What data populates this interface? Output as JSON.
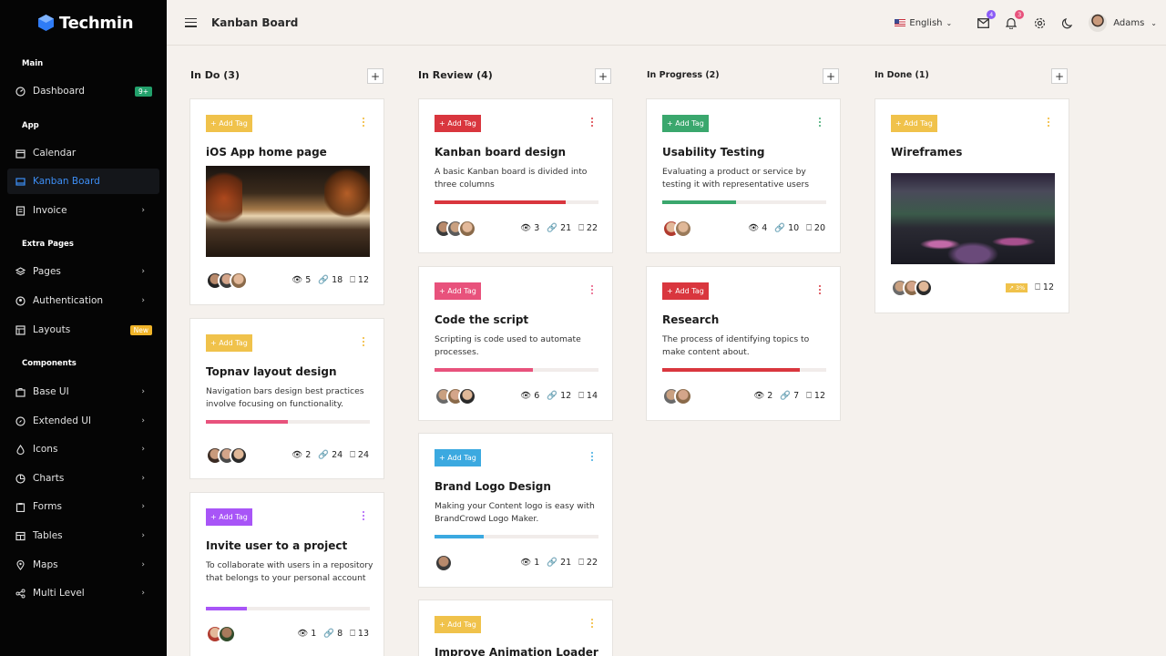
{
  "app": {
    "name": "Techmin"
  },
  "sidebar": {
    "sections": {
      "main": "Main",
      "app": "App",
      "extra": "Extra Pages",
      "components": "Components"
    },
    "items": [
      {
        "label": "Dashboard",
        "badge": "9+",
        "badge_color": "#22a06b"
      },
      {
        "label": "Calendar"
      },
      {
        "label": "Kanban Board"
      },
      {
        "label": "Invoice"
      },
      {
        "label": "Pages"
      },
      {
        "label": "Authentication"
      },
      {
        "label": "Layouts",
        "badge": "New",
        "badge_color": "#f0b429"
      },
      {
        "label": "Base UI"
      },
      {
        "label": "Extended UI"
      },
      {
        "label": "Icons"
      },
      {
        "label": "Charts"
      },
      {
        "label": "Forms"
      },
      {
        "label": "Tables"
      },
      {
        "label": "Maps"
      },
      {
        "label": "Multi Level"
      }
    ]
  },
  "header": {
    "title": "Kanban Board",
    "language": "English",
    "mail_count": "4",
    "notif_count": "3",
    "user": "Adams"
  },
  "columns": [
    {
      "title": "In Do (3)"
    },
    {
      "title": "In Review (4)"
    },
    {
      "title": "In Progress (2)"
    },
    {
      "title": "In Done (1)"
    }
  ],
  "cards": [
    {
      "tag": "+ Add Tag",
      "tag_color": "#f0c24b",
      "title": "iOS App home page",
      "views": "5",
      "links": "18",
      "comments": "12"
    },
    {
      "tag": "+ Add Tag",
      "tag_color": "#f0c24b",
      "title": "Topnav layout design",
      "desc": "Navigation bars design best practices involve focusing on functionality.",
      "progress": 0.5,
      "bar_color": "#e8527c",
      "views": "2",
      "links": "24",
      "comments": "24"
    },
    {
      "tag": "+ Add Tag",
      "tag_color": "#a855f7",
      "title": "Invite user to a project",
      "desc": "To collaborate with users in a repository that belongs to your personal account",
      "progress": 0.25,
      "bar_color": "#a855f7",
      "views": "1",
      "links": "8",
      "comments": "13"
    },
    {
      "tag": "+ Add Tag",
      "tag_color": "#d9363e",
      "title": "Kanban board design",
      "desc": "A basic Kanban board is divided into three columns",
      "progress": 0.8,
      "bar_color": "#d9363e",
      "views": "3",
      "links": "21",
      "comments": "22"
    },
    {
      "tag": "+ Add Tag",
      "tag_color": "#e8527c",
      "title": "Code the script",
      "desc": "Scripting is code used to automate processes.",
      "progress": 0.6,
      "bar_color": "#e8527c",
      "views": "6",
      "links": "12",
      "comments": "14"
    },
    {
      "tag": "+ Add Tag",
      "tag_color": "#3ba9e0",
      "title": "Brand Logo Design",
      "desc": "Making your Content logo is easy with BrandCrowd Logo Maker.",
      "progress": 0.3,
      "bar_color": "#3ba9e0",
      "views": "1",
      "links": "21",
      "comments": "22"
    },
    {
      "tag": "+ Add Tag",
      "tag_color": "#f0c24b",
      "title": "Improve Animation Loader"
    },
    {
      "tag": "+ Add Tag",
      "tag_color": "#3aa76d",
      "title": "Usability Testing",
      "desc": "Evaluating a product or service by testing it with representative users",
      "progress": 0.45,
      "bar_color": "#3aa76d",
      "views": "4",
      "links": "10",
      "comments": "20"
    },
    {
      "tag": "+ Add Tag",
      "tag_color": "#d9363e",
      "title": "Research",
      "desc": "The process of identifying topics to make content about.",
      "progress": 0.84,
      "bar_color": "#d9363e",
      "views": "2",
      "links": "7",
      "comments": "12"
    },
    {
      "tag": "+ Add Tag",
      "tag_color": "#f0c24b",
      "title": "Wireframes",
      "badge": "3%",
      "comments": "12"
    }
  ],
  "icons": {
    "eye": "eye-icon",
    "link": "link-icon",
    "comment": "comment-icon"
  }
}
